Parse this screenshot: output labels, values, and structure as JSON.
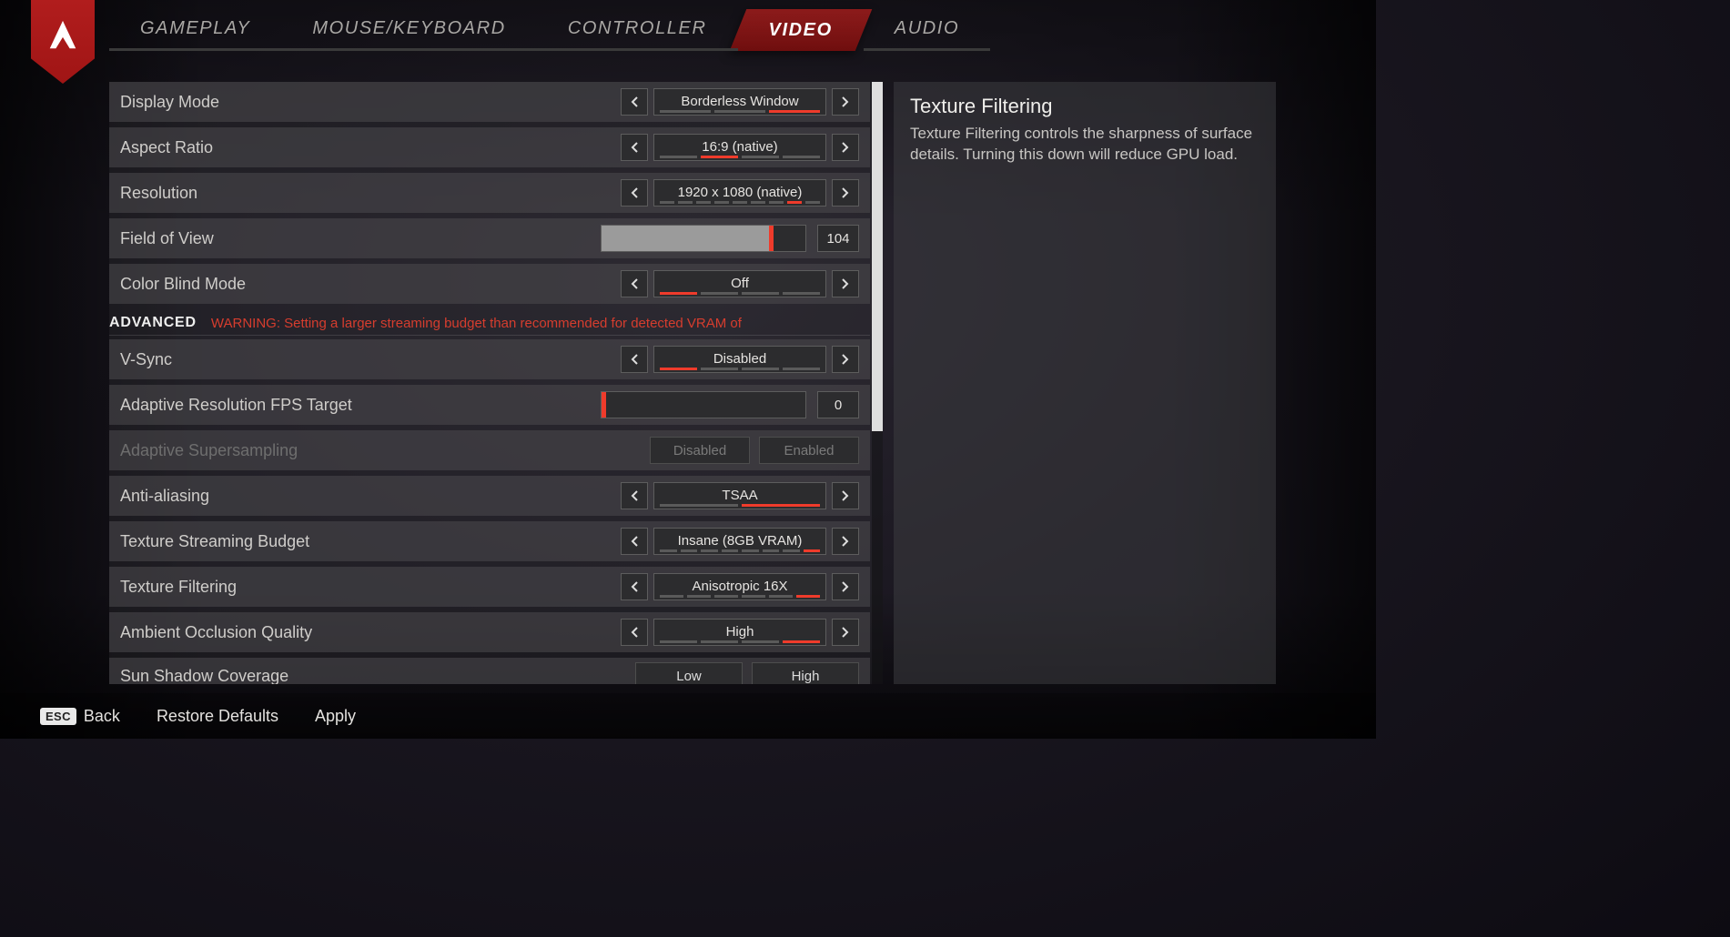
{
  "nav": {
    "tabs": [
      "GAMEPLAY",
      "MOUSE/KEYBOARD",
      "CONTROLLER",
      "VIDEO",
      "AUDIO"
    ],
    "active_index": 3
  },
  "info_panel": {
    "title": "Texture Filtering",
    "description": "Texture Filtering controls the sharpness of surface details. Turning this down will reduce GPU load."
  },
  "section_advanced": {
    "title": "ADVANCED",
    "warning": "WARNING: Setting a larger streaming budget than recommended for detected VRAM of"
  },
  "settings": {
    "display_mode": {
      "label": "Display Mode",
      "value": "Borderless Window",
      "ticks": [
        0,
        0,
        1
      ]
    },
    "aspect_ratio": {
      "label": "Aspect Ratio",
      "value": "16:9 (native)",
      "ticks": [
        0,
        1,
        0,
        0
      ]
    },
    "resolution": {
      "label": "Resolution",
      "value": "1920 x 1080 (native)",
      "ticks": [
        0,
        0,
        0,
        0,
        0,
        0,
        0,
        1,
        0
      ]
    },
    "field_of_view": {
      "label": "Field of View",
      "value": "104",
      "fill_pct": 82
    },
    "color_blind": {
      "label": "Color Blind Mode",
      "value": "Off",
      "ticks": [
        1,
        0,
        0,
        0
      ]
    },
    "vsync": {
      "label": "V-Sync",
      "value": "Disabled",
      "ticks": [
        1,
        0,
        0,
        0
      ]
    },
    "adaptive_fps": {
      "label": "Adaptive Resolution FPS Target",
      "value": "0",
      "fill_pct": 0
    },
    "adaptive_ss": {
      "label": "Adaptive Supersampling",
      "options": [
        "Disabled",
        "Enabled"
      ]
    },
    "anti_aliasing": {
      "label": "Anti-aliasing",
      "value": "TSAA",
      "ticks": [
        0,
        1
      ]
    },
    "texture_budget": {
      "label": "Texture Streaming Budget",
      "value": "Insane (8GB VRAM)",
      "ticks": [
        0,
        0,
        0,
        0,
        0,
        0,
        0,
        1
      ]
    },
    "texture_filtering": {
      "label": "Texture Filtering",
      "value": "Anisotropic 16X",
      "ticks": [
        0,
        0,
        0,
        0,
        0,
        1
      ]
    },
    "ambient_occlusion": {
      "label": "Ambient Occlusion Quality",
      "value": "High",
      "ticks": [
        0,
        0,
        0,
        1
      ]
    },
    "sun_shadow": {
      "label": "Sun Shadow Coverage",
      "options": [
        "Low",
        "High"
      ]
    }
  },
  "footer": {
    "back_key": "ESC",
    "back_label": "Back",
    "restore_label": "Restore Defaults",
    "apply_label": "Apply"
  }
}
